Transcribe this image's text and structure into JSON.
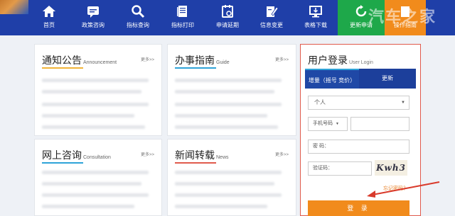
{
  "nav": {
    "items": [
      {
        "label": "首页",
        "icon": "home-icon"
      },
      {
        "label": "政策咨询",
        "icon": "chat-icon"
      },
      {
        "label": "指标查询",
        "icon": "search-icon"
      },
      {
        "label": "指标打印",
        "icon": "document-icon"
      },
      {
        "label": "申请延期",
        "icon": "calendar-icon"
      },
      {
        "label": "信息变更",
        "icon": "edit-icon"
      },
      {
        "label": "表格下载",
        "icon": "monitor-icon"
      },
      {
        "label": "更新申请",
        "icon": "refresh-icon"
      },
      {
        "label": "操作指南",
        "icon": "guide-icon"
      }
    ],
    "watermark": "汽车之家",
    "colors": {
      "bar": "#1f3fa8",
      "update": "#1ea84a",
      "guide": "#f18b1c"
    }
  },
  "panels": {
    "notice": {
      "title": "通知公告",
      "subtitle": "Announcement",
      "more": "更多>>"
    },
    "guide": {
      "title": "办事指南",
      "subtitle": "Guide",
      "more": "更多>>"
    },
    "consult": {
      "title": "网上咨询",
      "subtitle": "Consultation",
      "more": "更多>>"
    },
    "news": {
      "title": "新闻转载",
      "subtitle": "News",
      "more": "更多>>"
    }
  },
  "login": {
    "title": "用户登录",
    "subtitle": "User Login",
    "tab_active": "增量（摇号 竞价）",
    "tab_other": "更新",
    "type_select": "个人",
    "phone_select": "手机号码",
    "password_label": "密  码：",
    "captcha_label": "验证码：",
    "captcha_text": "Kwh3",
    "forgot": "忘记密码？",
    "submit": "登 录",
    "colors": {
      "border": "#e05a4c",
      "button": "#f18b1c",
      "tab": "#1f48a6"
    }
  }
}
